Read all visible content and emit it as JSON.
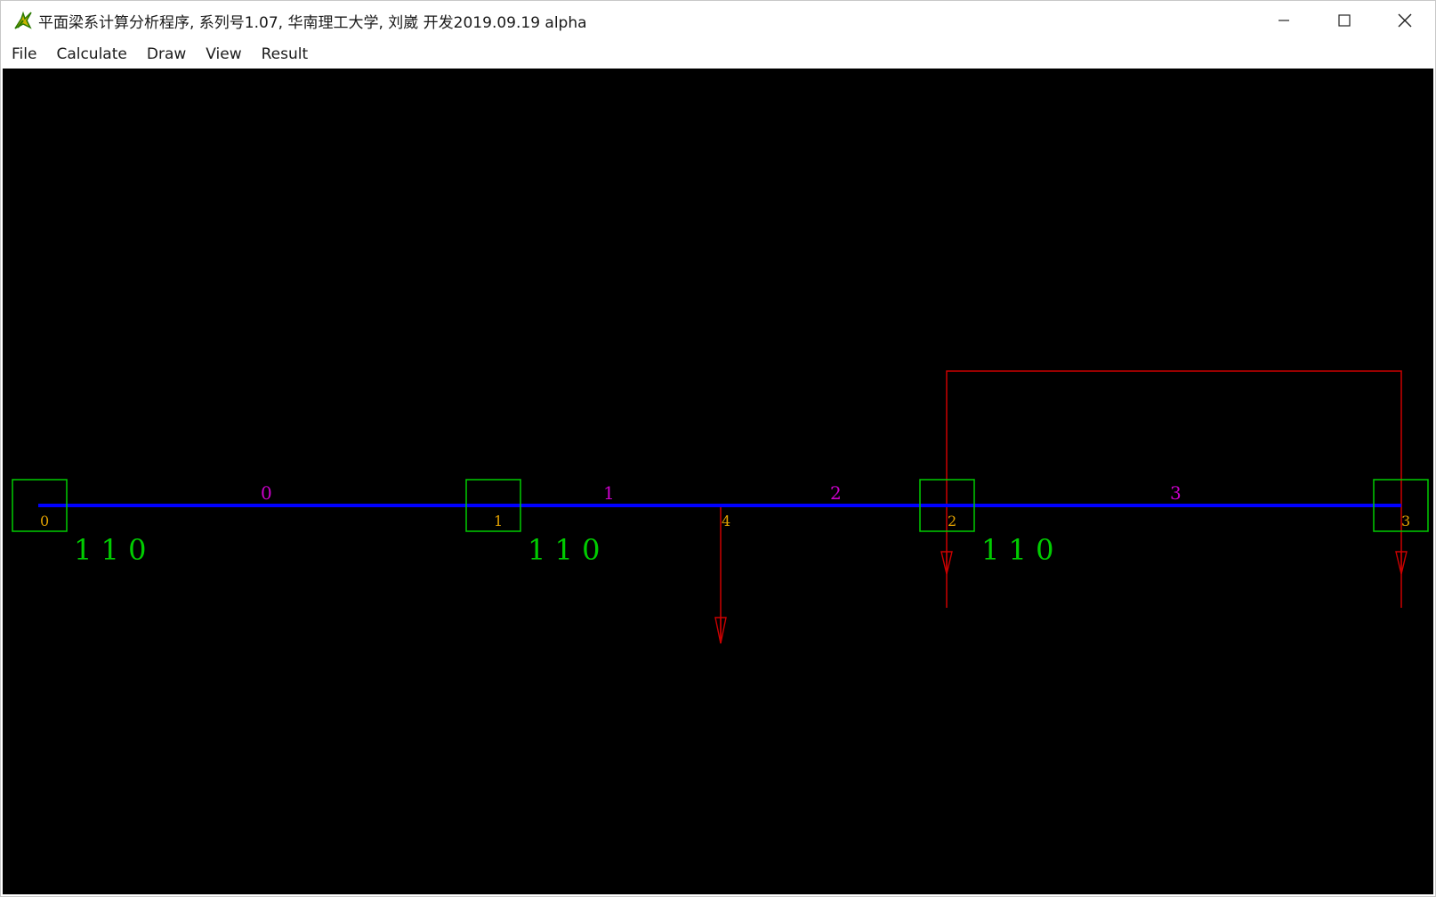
{
  "window": {
    "title": "平面梁系计算分析程序, 系列号1.07, 华南理工大学, 刘崴 开发2019.09.19 alpha",
    "controls": [
      "minimize-icon",
      "maximize-icon",
      "close-icon"
    ]
  },
  "menu": {
    "items": [
      "File",
      "Calculate",
      "Draw",
      "View",
      "Result"
    ]
  },
  "colors": {
    "canvas_bg": "#000000",
    "beam": "#0000ff",
    "node_box": "#00cc00",
    "node_label": "#e0a000",
    "element_label": "#cc00cc",
    "constraint_label": "#00cc00",
    "load": "#cc0000"
  },
  "model": {
    "nodes": [
      {
        "id": "0",
        "constraint": "1 1 0"
      },
      {
        "id": "1",
        "constraint": "1 1 0"
      },
      {
        "id": "2",
        "constraint": "1 1 0"
      },
      {
        "id": "3",
        "constraint": ""
      }
    ],
    "elements": [
      "0",
      "1",
      "2",
      "3"
    ],
    "load_point_label": "4"
  }
}
